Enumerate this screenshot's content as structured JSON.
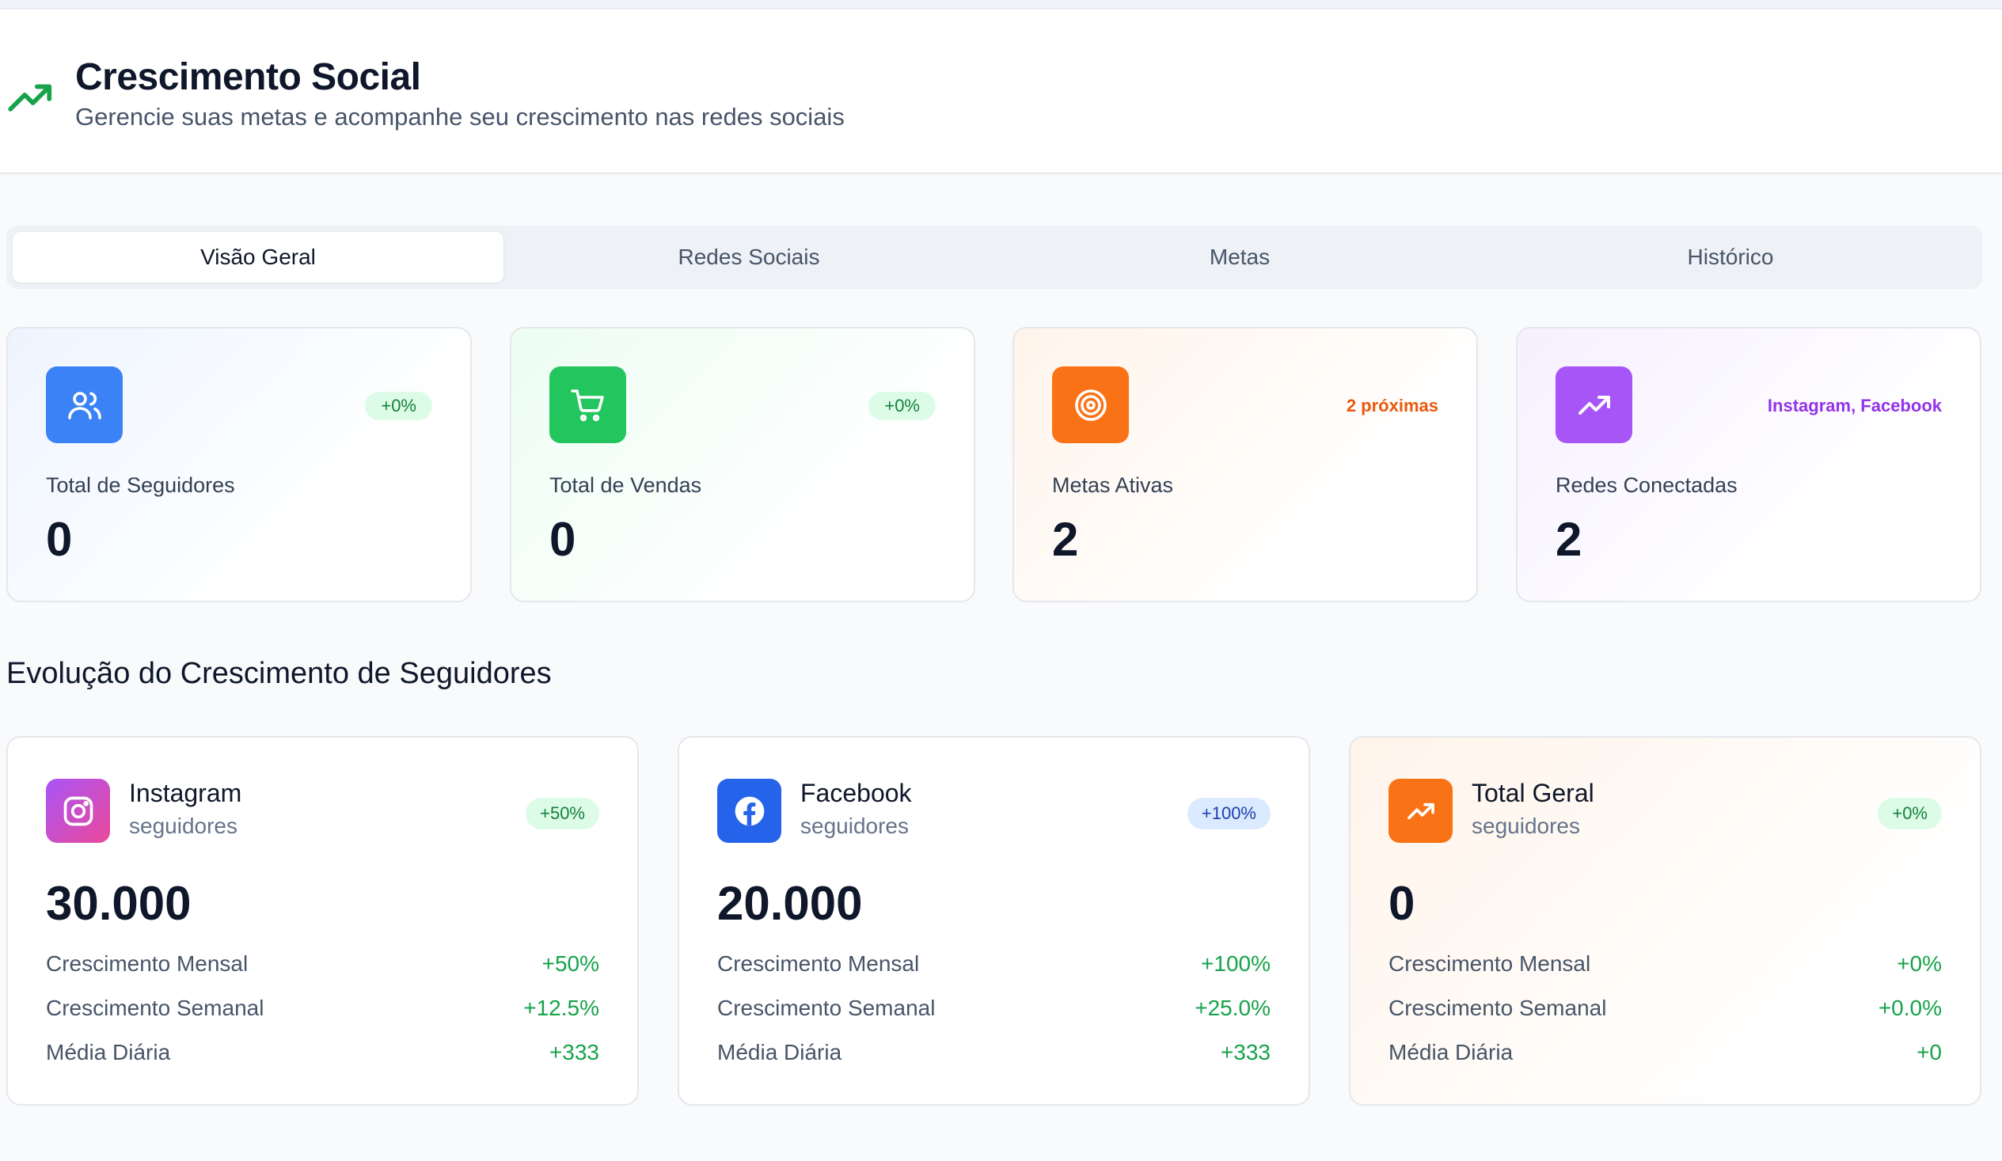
{
  "header": {
    "title": "Crescimento Social",
    "subtitle": "Gerencie suas metas e acompanhe seu crescimento nas redes sociais",
    "icon": "trending-up-icon",
    "accent": "#16a34a"
  },
  "tabs": [
    {
      "label": "Visão Geral",
      "active": true
    },
    {
      "label": "Redes Sociais",
      "active": false
    },
    {
      "label": "Metas",
      "active": false
    },
    {
      "label": "Histórico",
      "active": false
    }
  ],
  "stats": [
    {
      "icon": "users-icon",
      "color": "#3b82f6",
      "badge": "+0%",
      "label": "Total de Seguidores",
      "value": "0"
    },
    {
      "icon": "cart-icon",
      "color": "#22c55e",
      "badge": "+0%",
      "label": "Total de Vendas",
      "value": "0"
    },
    {
      "icon": "target-icon",
      "color": "#f97316",
      "badge": "2 próximas",
      "label": "Metas Ativas",
      "value": "2"
    },
    {
      "icon": "trending-up-icon",
      "color": "#a855f7",
      "badge": "Instagram, Facebook",
      "label": "Redes Conectadas",
      "value": "2"
    }
  ],
  "section_title": "Evolução do Crescimento de Seguidores",
  "networks": [
    {
      "name": "Instagram",
      "unit": "seguidores",
      "badge": "+50%",
      "value": "30.000",
      "icon": "instagram-icon",
      "rows": [
        {
          "label": "Crescimento Mensal",
          "value": "+50%"
        },
        {
          "label": "Crescimento Semanal",
          "value": "+12.5%"
        },
        {
          "label": "Média Diária",
          "value": "+333"
        }
      ]
    },
    {
      "name": "Facebook",
      "unit": "seguidores",
      "badge": "+100%",
      "value": "20.000",
      "icon": "facebook-icon",
      "rows": [
        {
          "label": "Crescimento Mensal",
          "value": "+100%"
        },
        {
          "label": "Crescimento Semanal",
          "value": "+25.0%"
        },
        {
          "label": "Média Diária",
          "value": "+333"
        }
      ]
    },
    {
      "name": "Total Geral",
      "unit": "seguidores",
      "badge": "+0%",
      "value": "0",
      "icon": "trending-up-icon",
      "rows": [
        {
          "label": "Crescimento Mensal",
          "value": "+0%"
        },
        {
          "label": "Crescimento Semanal",
          "value": "+0.0%"
        },
        {
          "label": "Média Diária",
          "value": "+0"
        }
      ]
    }
  ]
}
